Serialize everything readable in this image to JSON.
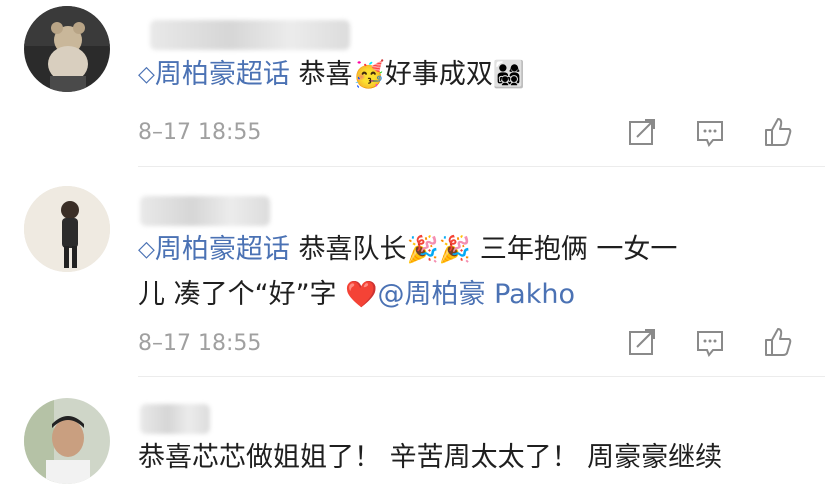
{
  "comments": [
    {
      "topic_prefix": "◇",
      "topic": "周柏豪超话",
      "text_before_emoji": " 恭喜",
      "emoji_1": "🥳",
      "text_after_emoji": "好事成双",
      "emoji_2": "👨‍👩‍👧‍👦",
      "time": "8–17 18:55"
    },
    {
      "topic_prefix": "◇",
      "topic": "周柏豪超话",
      "line1_text": " 恭喜队长",
      "emoji_1": "🎉🎉",
      "line1_rest": " 三年抱俩 一女一",
      "line2_text": "儿 凑了个“好”字 ",
      "emoji_2": "❤️",
      "mention": "@周柏豪 Pakho",
      "time": "8–17 18:55"
    },
    {
      "line1_text": "恭喜芯芯做姐姐了！ 辛苦周太太了！ 周豪豪继续"
    }
  ],
  "icons": {
    "share": "share-icon",
    "comment": "comment-icon",
    "like": "like-icon"
  }
}
